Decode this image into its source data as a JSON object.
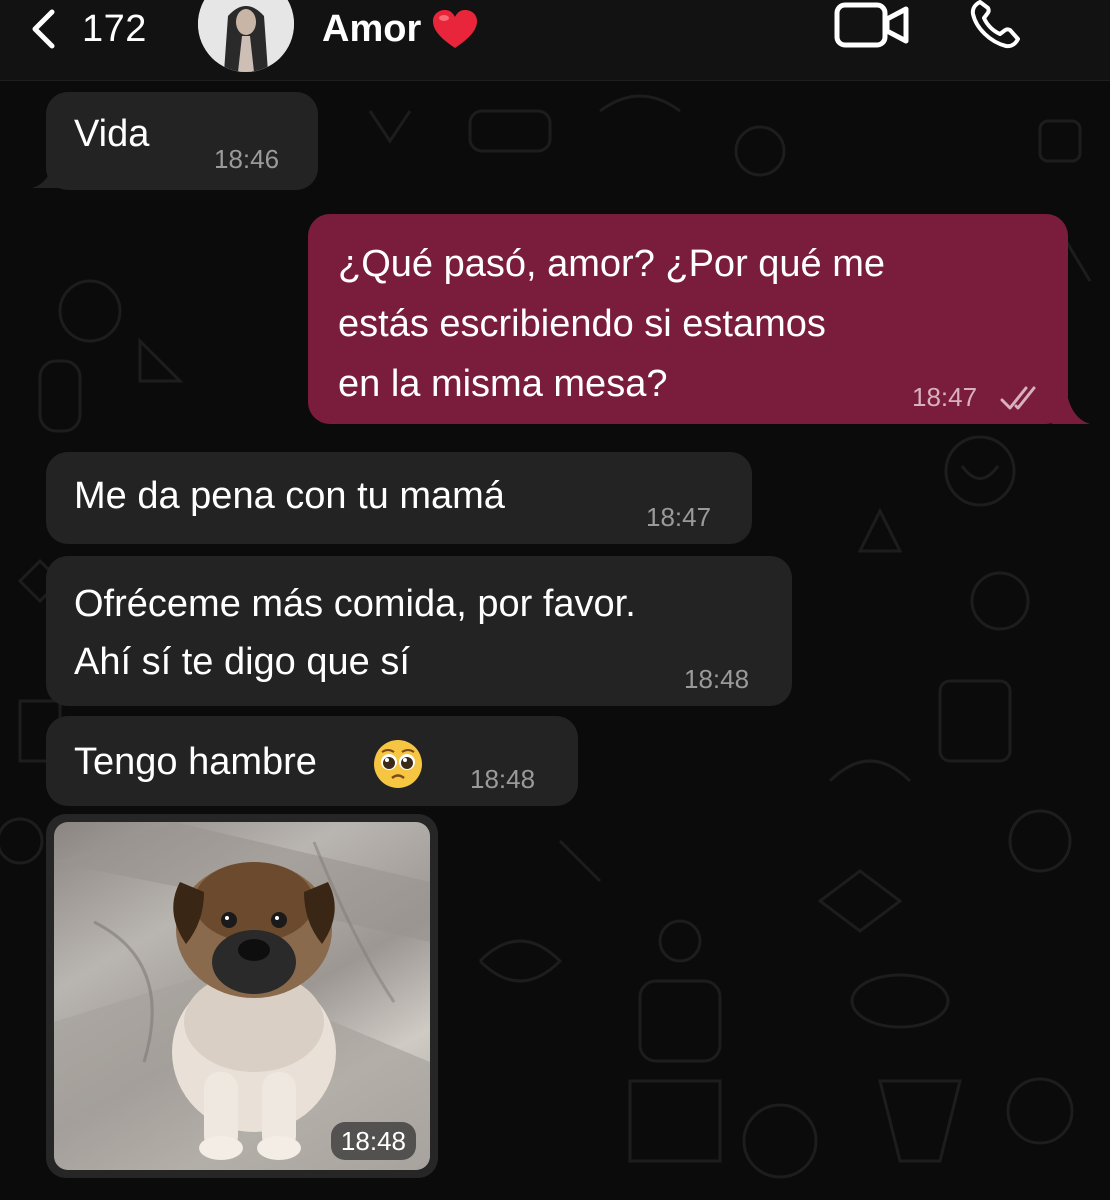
{
  "header": {
    "back_count": "172",
    "contact_name": "Amor",
    "heart_color": "#e8253a"
  },
  "messages": [
    {
      "direction": "incoming",
      "text_lines": [
        "Vida"
      ],
      "time": "18:46"
    },
    {
      "direction": "outgoing",
      "text_lines": [
        "¿Qué pasó, amor? ¿Por qué me",
        "estás escribiendo si estamos",
        "en la misma mesa?"
      ],
      "time": "18:47",
      "status": "read"
    },
    {
      "direction": "incoming",
      "text_lines": [
        "Me da pena con tu mamá"
      ],
      "time": "18:47"
    },
    {
      "direction": "incoming",
      "text_lines": [
        "Ofréceme más comida, por favor.",
        "Ahí sí te digo que sí"
      ],
      "time": "18:48"
    },
    {
      "direction": "incoming",
      "text_lines": [
        "Tengo hambre"
      ],
      "emoji": "pleading-face",
      "time": "18:48"
    },
    {
      "direction": "incoming",
      "type": "photo",
      "photo_subject": "puppy",
      "time": "18:48"
    }
  ],
  "colors": {
    "chat_background": "#0b0b0b",
    "incoming_bubble": "#232323",
    "outgoing_bubble": "#7a1d3c"
  }
}
